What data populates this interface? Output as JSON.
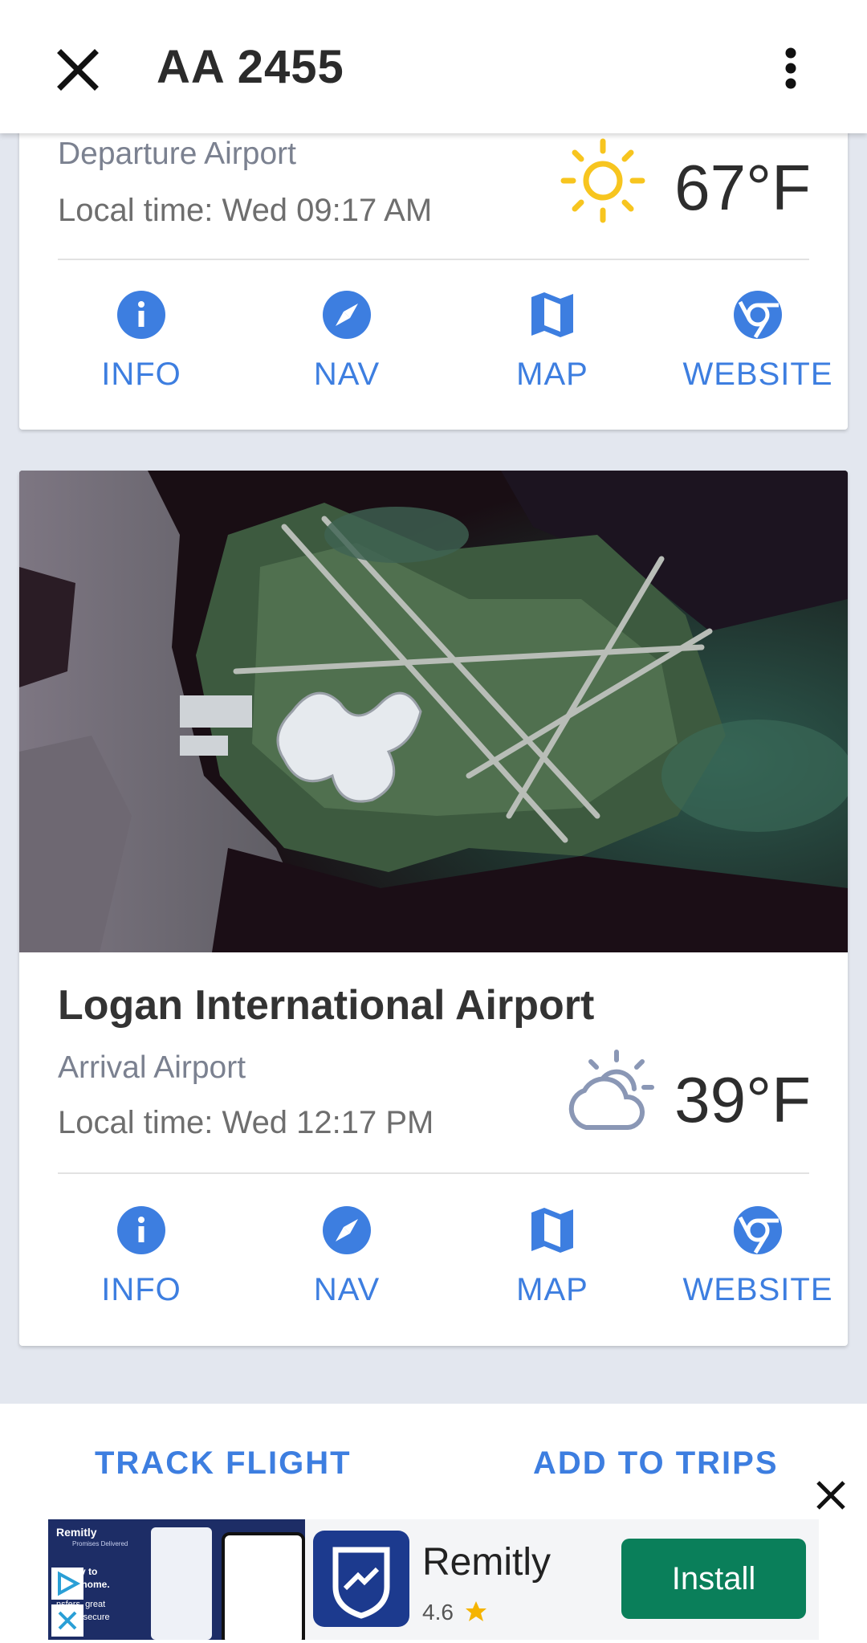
{
  "header": {
    "title": "AA 2455",
    "close_icon": "close-icon",
    "more_icon": "more-vert-icon"
  },
  "departure": {
    "role": "Departure Airport",
    "local_time": "Local time: Wed 09:17 AM",
    "temperature": "67°F",
    "weather_icon": "sunny-icon"
  },
  "arrival": {
    "name": "Logan International Airport",
    "role": "Arrival Airport",
    "local_time": "Local time: Wed 12:17 PM",
    "temperature": "39°F",
    "weather_icon": "partly-cloudy-icon"
  },
  "actions": {
    "info": "INFO",
    "nav": "NAV",
    "map": "MAP",
    "website": "WEBSITE"
  },
  "bottom": {
    "track": "TRACK FLIGHT",
    "add": "ADD TO TRIPS"
  },
  "ad": {
    "app_name": "Remitly",
    "rating": "4.6",
    "install": "Install",
    "thumb_brand": "Remitly",
    "thumb_tag": "Promises Delivered",
    "thumb_line1": "st way to",
    "thumb_line2": "oney home.",
    "thumb_line3": "nsfers, great",
    "thumb_line4": "fe and secure"
  },
  "colors": {
    "accent": "#3d7ee0",
    "install": "#0a7f5a",
    "sun": "#f7c51f",
    "cloud": "#8a97b5"
  }
}
